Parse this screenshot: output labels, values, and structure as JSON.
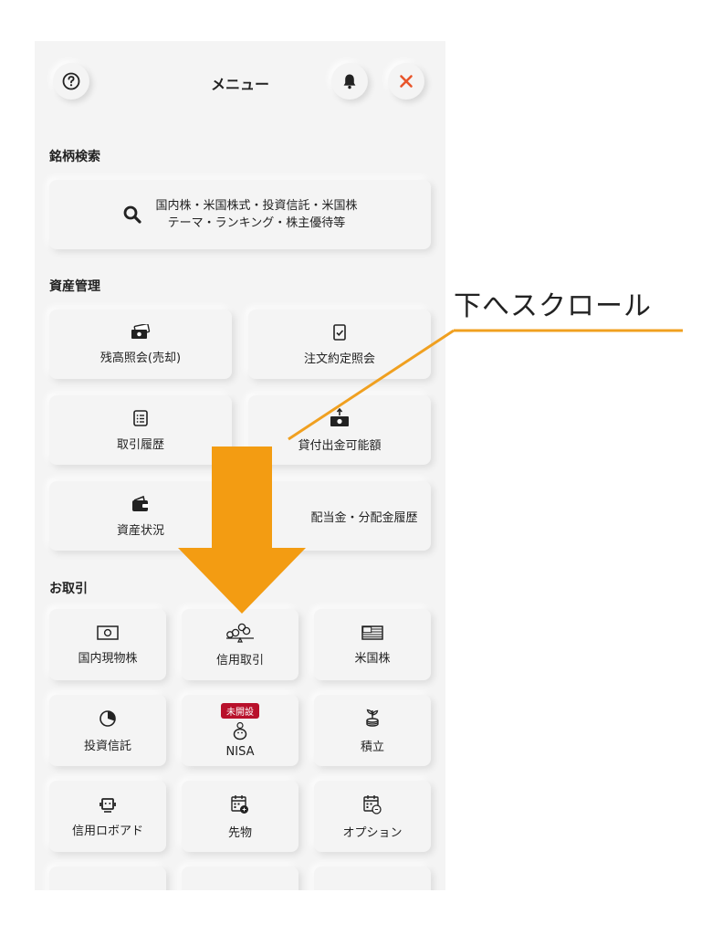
{
  "header": {
    "title": "メニュー"
  },
  "sections": {
    "search": {
      "title": "銘柄検索",
      "line1": "国内株・米国株式・投資信託・米国株",
      "line2": "テーマ・ランキング・株主優待等"
    },
    "assets": {
      "title": "資産管理",
      "items": [
        {
          "label": "残高照会(売却)",
          "icon": "cash-icon"
        },
        {
          "label": "注文約定照会",
          "icon": "checklist-icon"
        },
        {
          "label": "取引履歴",
          "icon": "list-icon"
        },
        {
          "label": "貸付出金可能額",
          "icon": "withdraw-icon"
        },
        {
          "label": "資産状況",
          "icon": "wallet-icon"
        },
        {
          "label": "配当金・分配金履歴",
          "icon": "dividend-icon"
        }
      ]
    },
    "trading": {
      "title": "お取引",
      "items": [
        {
          "label": "国内現物株",
          "icon": "banknote-icon"
        },
        {
          "label": "信用取引",
          "icon": "coins-icon"
        },
        {
          "label": "米国株",
          "icon": "us-flag-icon"
        },
        {
          "label": "投資信託",
          "icon": "pie-chart-icon"
        },
        {
          "label": "NISA",
          "icon": "piggy-bank-icon",
          "badge": "未開設"
        },
        {
          "label": "積立",
          "icon": "plant-coins-icon"
        },
        {
          "label": "信用ロボアド",
          "icon": "robot-icon"
        },
        {
          "label": "先物",
          "icon": "calendar-futures-icon"
        },
        {
          "label": "オプション",
          "icon": "calendar-options-icon"
        }
      ]
    }
  },
  "annotation": {
    "text": "下へスクロール"
  },
  "colors": {
    "close": "#e8552a",
    "badge": "#b8102b",
    "arrow": "#f39c12",
    "line": "#f0a020"
  }
}
